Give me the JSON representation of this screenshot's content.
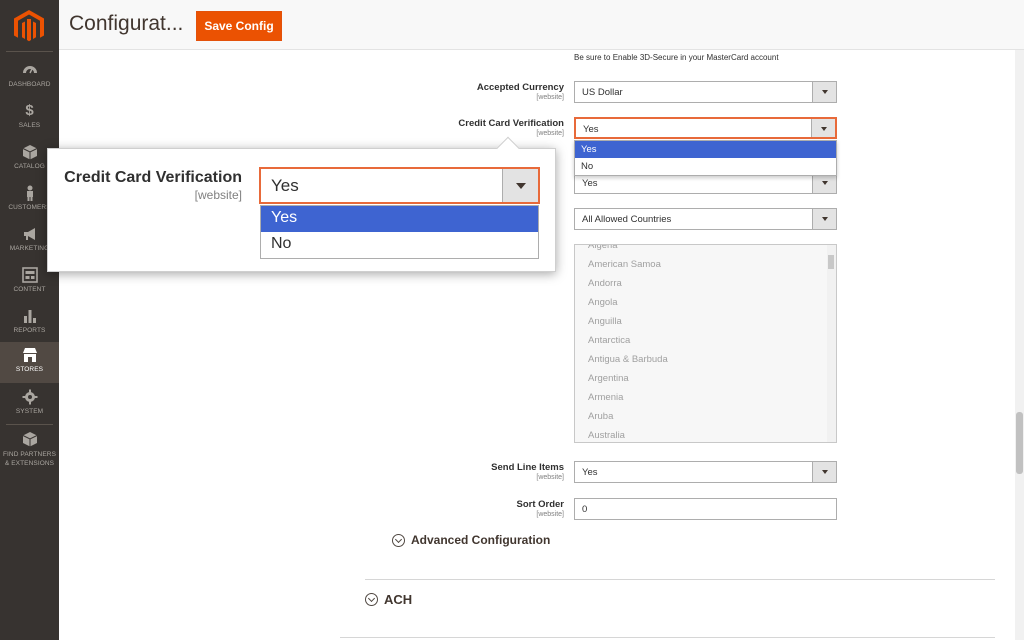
{
  "sidebar": {
    "items": [
      {
        "label": "DASHBOARD"
      },
      {
        "label": "SALES"
      },
      {
        "label": "CATALOG"
      },
      {
        "label": "CUSTOMERS"
      },
      {
        "label": "MARKETING"
      },
      {
        "label": "CONTENT"
      },
      {
        "label": "REPORTS"
      },
      {
        "label": "STORES"
      },
      {
        "label": "SYSTEM"
      },
      {
        "label": "FIND PARTNERS & EXTENSIONS"
      }
    ],
    "active": "STORES"
  },
  "header": {
    "title": "Configurat...",
    "save_label": "Save Config"
  },
  "form": {
    "note": "Be sure to Enable 3D-Secure in your MasterCard account",
    "accepted_currency": {
      "label": "Accepted Currency",
      "scope": "[website]",
      "value": "US Dollar"
    },
    "ccv": {
      "label": "Credit Card Verification",
      "scope": "[website]",
      "value": "Yes",
      "options": [
        "Yes",
        "No"
      ],
      "selected_option": "Yes"
    },
    "hidden_row1": {
      "value": "Yes"
    },
    "allowed_countries": {
      "value": "All Allowed Countries"
    },
    "countries": [
      "Algeria",
      "American Samoa",
      "Andorra",
      "Angola",
      "Anguilla",
      "Antarctica",
      "Antigua & Barbuda",
      "Argentina",
      "Armenia",
      "Aruba",
      "Australia"
    ],
    "send_line_items": {
      "label": "Send Line Items",
      "scope": "[website]",
      "value": "Yes"
    },
    "sort_order": {
      "label": "Sort Order",
      "scope": "[website]",
      "value": "0"
    },
    "advanced_label": "Advanced Configuration",
    "ach_label": "ACH"
  },
  "zoom": {
    "label": "Credit Card Verification",
    "scope": "[website]",
    "value": "Yes",
    "options": [
      "Yes",
      "No"
    ]
  },
  "colors": {
    "accent": "#eb5202",
    "sidebar": "#373330",
    "focus": "#e86a3a",
    "selected": "#3e64d1"
  }
}
